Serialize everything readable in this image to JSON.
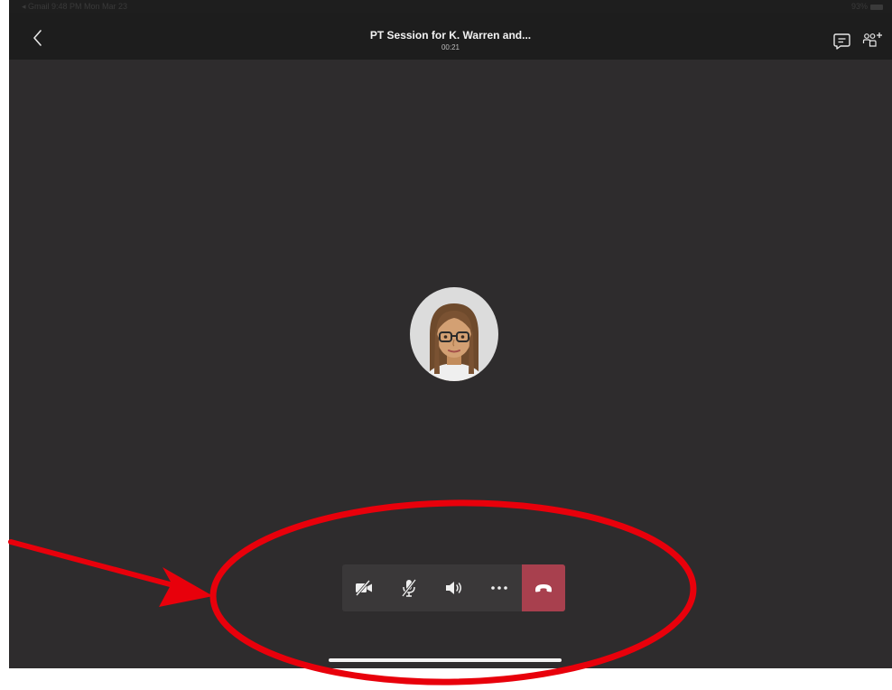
{
  "status_bar": {
    "left_text": "◂ Gmail  9:48 PM  Mon Mar 23",
    "right_text": "93%"
  },
  "header": {
    "title": "PT Session for K. Warren and...",
    "timer": "00:21",
    "back_icon": "chevron-left-icon",
    "chat_icon": "chat-icon",
    "participants_icon": "add-participants-icon"
  },
  "avatar": {
    "icon": "person-avatar"
  },
  "controls": [
    {
      "name": "camera-off-button",
      "icon": "camera-off-icon"
    },
    {
      "name": "mute-button",
      "icon": "microphone-off-icon"
    },
    {
      "name": "speaker-button",
      "icon": "speaker-icon"
    },
    {
      "name": "more-options-button",
      "icon": "more-dots-icon"
    },
    {
      "name": "hang-up-button",
      "icon": "hang-up-icon"
    }
  ],
  "colors": {
    "background": "#2e2c2d",
    "topbar": "#1d1d1d",
    "control_bar": "#3a3839",
    "hang_up": "#a8404e",
    "annotation": "#e8000b"
  }
}
